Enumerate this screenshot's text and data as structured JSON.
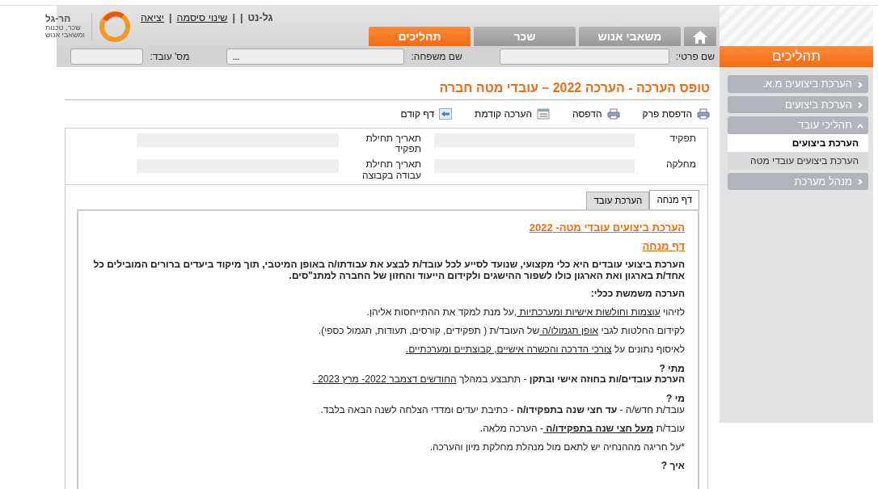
{
  "logo": {
    "name": "הר-גל",
    "tagline": [
      "שכר, טכנות",
      "ומשאבי אנוש"
    ]
  },
  "user_links": [
    {
      "text": "גל-נט",
      "kind": "text"
    },
    {
      "text": "|",
      "kind": "sep"
    },
    {
      "text": "|",
      "kind": "sep"
    },
    {
      "text": "שינוי סיסמה",
      "kind": "link"
    },
    {
      "text": "|",
      "kind": "sep"
    },
    {
      "text": "יציאה",
      "kind": "link"
    }
  ],
  "main_tabs": [
    {
      "kind": "home",
      "selected": false
    },
    {
      "label": "משאבי אנוש",
      "kind": "text",
      "selected": false
    },
    {
      "label": "שכר",
      "kind": "text",
      "selected": false
    },
    {
      "label": "תהליכים",
      "kind": "text",
      "selected": true
    }
  ],
  "employee_bar": [
    {
      "label": "שם פרטי:"
    },
    {
      "label": "שם משפחה:",
      "value": "..."
    },
    {
      "label": "מס' עובד:"
    }
  ],
  "page_title": "טופס הערכה - הערכה 2022 – עובדי מטה חברה",
  "toolbar": [
    {
      "label": "הדפסת פרק",
      "kind": "printer"
    },
    {
      "label": "הדפסה",
      "kind": "printer"
    },
    {
      "label": "הערכה קודמת",
      "kind": "window"
    },
    {
      "label": "דף קודם",
      "kind": "back"
    }
  ],
  "details": [
    {
      "label": "תפקיד"
    },
    {
      "label": "תאריך תחילת תפקיד"
    },
    {
      "label": "מחלקה"
    },
    {
      "label": "תאריך תחילת עבודה בקבוצה"
    }
  ],
  "form_tabs": [
    {
      "label": "דף מנחה",
      "selected": true
    },
    {
      "label": "הערכת עובד",
      "selected": false
    }
  ],
  "document": [
    {
      "kind": "heading",
      "parts": [
        {
          "t": "הערכת ביצועים עובדי מטה- 2022"
        }
      ]
    },
    {
      "kind": "heading",
      "parts": [
        {
          "t": "דף מנחה"
        }
      ]
    },
    {
      "kind": "text",
      "parts": [
        {
          "t": "הערכת ביצועי עובדים היא כלי מקצועי, שנועד לסייע לכל עובד/ת לבצע את עבודתו/ה באופן המיטבי, תוך מיקוד ביעדים ברורים המובילים כל אחד/ת בארגון ואת הארגון כולו לשפור ההישגים ולקידום הייעוד והחזון של החברה למתנ\"סים.",
          "b": true
        }
      ]
    },
    {
      "kind": "text",
      "parts": [
        {
          "t": "הערכה משמשת ככלי:",
          "b": true
        }
      ]
    },
    {
      "kind": "text",
      "parts": [
        {
          "t": "לזיהוי "
        },
        {
          "t": "עוצמות וחולשות אישיות ומערכתיות ",
          "u": true
        },
        {
          "t": ",על מנת למקד את ההתייחסות אליהן."
        }
      ]
    },
    {
      "kind": "text",
      "parts": [
        {
          "t": "לקידום החלטות לגבי "
        },
        {
          "t": "אופן תגמולו/ה ",
          "u": true
        },
        {
          "t": "של העובד/ת ( תפקידים, קורסים, תעודות, תגמול כספי)."
        }
      ]
    },
    {
      "kind": "text",
      "parts": [
        {
          "t": "לאיסוף נתונים על "
        },
        {
          "t": "צורכי הדרכה והכשרה אישיים, קבוצתיים ומערכתיים.",
          "u": true
        }
      ]
    },
    {
      "kind": "question",
      "parts": [
        {
          "t": "מתי ?",
          "b": true
        }
      ]
    },
    {
      "kind": "text",
      "parts": [
        {
          "t": "הערכת עובדים/ות בחוזה אישי ובתקן",
          "b": true
        },
        {
          "t": " - תתבצע במהלך "
        },
        {
          "t": "החודשים דצמבר 2022- מרץ 2023 .",
          "u": true
        }
      ]
    },
    {
      "kind": "question",
      "parts": [
        {
          "t": "מי ?",
          "b": true
        }
      ]
    },
    {
      "kind": "text",
      "parts": [
        {
          "t": "עובד/ת חדש/ה - "
        },
        {
          "t": "עד חצי שנה בתפקידו/ה",
          "b": true
        },
        {
          "t": " - כתיבת יעדים ומדדי הצלחה לשנה הבאה בלבד."
        }
      ]
    },
    {
      "kind": "text",
      "parts": [
        {
          "t": "עובד/ת "
        },
        {
          "t": "מעל חצי שנה בתפקידו/ה ",
          "b": true,
          "u": true
        },
        {
          "t": "- הערכה מלאה."
        }
      ]
    },
    {
      "kind": "text",
      "parts": [
        {
          "t": "*על חריגה מההנחיה יש לתאם מול מנהלת מחלקת מיון והערכה."
        }
      ]
    },
    {
      "kind": "question",
      "parts": [
        {
          "t": "איך ?",
          "b": true
        }
      ]
    }
  ],
  "sidebar": {
    "title": "תהליכים",
    "items": [
      {
        "label": "הערכת ביצועים מ.א.",
        "expanded": false
      },
      {
        "label": "הערכת ביצועים",
        "expanded": false
      },
      {
        "label": "תהליכי עובד",
        "expanded": true,
        "children": [
          {
            "label": "הערכת ביצועים",
            "selected": true
          },
          {
            "label": "הערכת ביצועים עובדי מטה",
            "selected": false
          }
        ]
      },
      {
        "label": "מנהל מערכת",
        "expanded": false
      }
    ]
  }
}
